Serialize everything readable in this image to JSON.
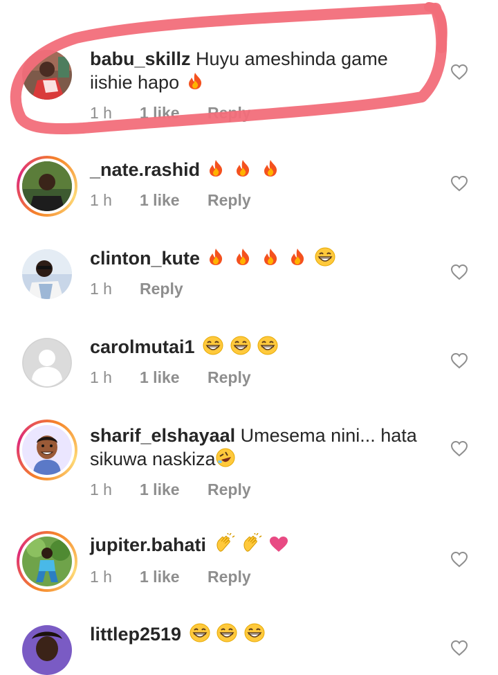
{
  "comments": [
    {
      "username": "babu_skillz",
      "text": " Huyu ameshinda game iishie hapo",
      "emojis": [
        "fire"
      ],
      "time": "1 h",
      "likes": "1 like",
      "reply": "Reply",
      "avatar": "photo-red",
      "story_ring": false
    },
    {
      "username": "_nate.rashid",
      "text": " ",
      "emojis": [
        "fire",
        "fire",
        "fire"
      ],
      "time": "1 h",
      "likes": "1 like",
      "reply": "Reply",
      "avatar": "photo-dark",
      "story_ring": true
    },
    {
      "username": "clinton_kute",
      "text": " ",
      "emojis": [
        "fire",
        "fire",
        "fire",
        "fire",
        "grin"
      ],
      "time": "1 h",
      "likes": "",
      "reply": "Reply",
      "avatar": "photo-blue",
      "story_ring": false
    },
    {
      "username": "carolmutai1",
      "text": " ",
      "emojis": [
        "grin",
        "grin",
        "grin"
      ],
      "time": "1 h",
      "likes": "1 like",
      "reply": "Reply",
      "avatar": "default-avatar",
      "story_ring": false
    },
    {
      "username": "sharif_elshayaal",
      "text": " Umesema nini... hata sikuwa naskiza",
      "emojis": [
        "rofl"
      ],
      "time": "1 h",
      "likes": "1 like",
      "reply": "Reply",
      "avatar": "cartoon-face",
      "story_ring": true
    },
    {
      "username": "jupiter.bahati",
      "text": " ",
      "emojis": [
        "clap",
        "clap",
        "heart"
      ],
      "time": "1 h",
      "likes": "1 like",
      "reply": "Reply",
      "avatar": "photo-green",
      "story_ring": true
    },
    {
      "username": "littlep2519",
      "text": " ",
      "emojis": [
        "grin",
        "grin",
        "grin"
      ],
      "time": "",
      "likes": "",
      "reply": "",
      "avatar": "photo-purple",
      "story_ring": false
    }
  ],
  "colors": {
    "text": "#262626",
    "meta": "#8e8e8e",
    "annotation": "#f26e7a"
  },
  "icons": {
    "like": "heart-outline-icon"
  }
}
